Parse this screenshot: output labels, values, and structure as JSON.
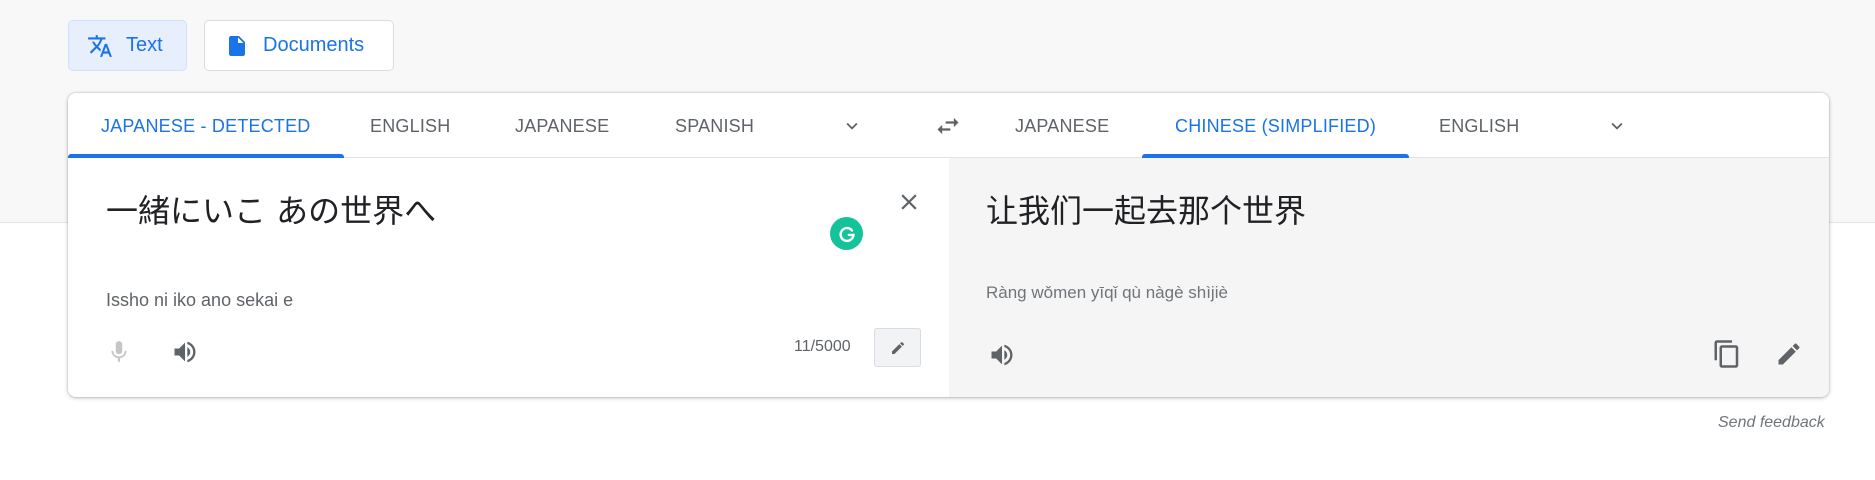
{
  "modes": {
    "text_label": "Text",
    "documents_label": "Documents"
  },
  "source": {
    "tabs": [
      "JAPANESE - DETECTED",
      "ENGLISH",
      "JAPANESE",
      "SPANISH"
    ],
    "text": "一緒にいこ あの世界へ",
    "romanization": "Issho ni iko ano sekai e",
    "char_count": "11/5000"
  },
  "target": {
    "tabs": [
      "JAPANESE",
      "CHINESE (SIMPLIFIED)",
      "ENGLISH"
    ],
    "text": "让我们一起去那个世界",
    "romanization": "Ràng wǒmen yīqǐ qù nàgè shìjiè"
  },
  "footer": {
    "feedback_label": "Send feedback"
  },
  "colors": {
    "accent": "#1a73e8",
    "grammarly": "#15c39a",
    "target_bg": "#f5f5f5"
  },
  "icons": {
    "text_mode": "translate-icon",
    "documents_mode": "document-icon",
    "swap": "swap-horiz-icon",
    "clear": "close-icon",
    "mic": "mic-icon",
    "listen": "volume-up-icon",
    "copy": "copy-icon",
    "edit": "pencil-icon",
    "share": "share-icon"
  }
}
